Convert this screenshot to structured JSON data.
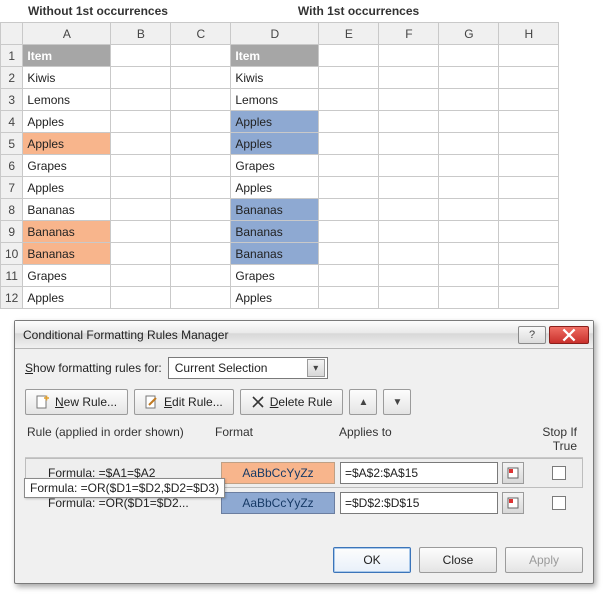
{
  "headers": {
    "left": "Without 1st occurrences",
    "right": "With 1st occurrences"
  },
  "cols": [
    "A",
    "B",
    "C",
    "D",
    "E",
    "F",
    "G",
    "H"
  ],
  "rows": [
    1,
    2,
    3,
    4,
    5,
    6,
    7,
    8,
    9,
    10,
    11,
    12
  ],
  "sheet": {
    "A1": "Item",
    "D1": "Item",
    "list": [
      "Kiwis",
      "Lemons",
      "Apples",
      "Apples",
      "Grapes",
      "Apples",
      "Bananas",
      "Bananas",
      "Bananas",
      "Grapes",
      "Apples"
    ]
  },
  "highlightA": {
    "orange": [
      5,
      9,
      10
    ]
  },
  "highlightD": {
    "blue": [
      4,
      5,
      8,
      9,
      10
    ]
  },
  "dialog": {
    "title": "Conditional Formatting Rules Manager",
    "showfor_label_pre": "S",
    "showfor_label_rest": "how formatting rules for:",
    "showfor_value": "Current Selection",
    "btn_new_pre": "N",
    "btn_new_rest": "ew Rule...",
    "btn_edit_pre": "E",
    "btn_edit_rest": "dit Rule...",
    "btn_delete_pre": "D",
    "btn_delete_rest": "elete Rule",
    "hdr_rule": "Rule (applied in order shown)",
    "hdr_format": "Format",
    "hdr_applies": "Applies to",
    "hdr_stop": "Stop If True",
    "format_sample": "AaBbCcYyZz",
    "rules": [
      {
        "label": "Formula: =$A1=$A2",
        "fmtClass": "fmt-orange",
        "applies": "=$A$2:$A$15"
      },
      {
        "label": "Formula: =OR($D1=$D2...",
        "fmtClass": "fmt-blue",
        "applies": "=$D$2:$D$15"
      }
    ],
    "tooltip": "Formula: =OR($D1=$D2,$D2=$D3)",
    "btn_ok": "OK",
    "btn_close": "Close",
    "btn_apply": "Apply"
  }
}
